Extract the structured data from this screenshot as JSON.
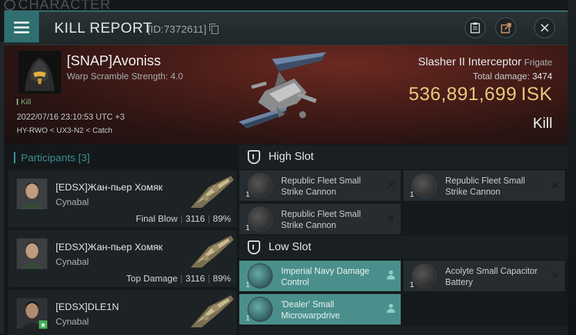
{
  "background": {
    "label": "CHARACTER"
  },
  "window": {
    "title": "KILL REPORT",
    "id_text": "[ID:7372611]",
    "accent": "#2f6f6f"
  },
  "victim": {
    "pilot": "[SNAP]Avoniss",
    "warp_text": "Warp Scramble Strength: 4.0",
    "kill_tag": "Kill",
    "timestamp": "2022/07/16 23:10:53 UTC +3",
    "route": "HY-RWO < UX3-N2 < Catch",
    "ship_name": "Slasher II Interceptor",
    "ship_class": "Frigate",
    "damage_label": "Total damage:",
    "damage_value": "3474",
    "isk_value": "536,891,699",
    "isk_unit": "ISK",
    "result": "Kill"
  },
  "participants": {
    "header": "Participants [3]",
    "rows": [
      {
        "name": "[EDSX]Жан-пьер Хомяк",
        "corp": "Cynabal",
        "role": "Final Blow",
        "damage": "3116",
        "percent": "89%"
      },
      {
        "name": "[EDSX]Жан-пьер Хомяк",
        "corp": "Cynabal",
        "role": "Top Damage",
        "damage": "3116",
        "percent": "89%"
      },
      {
        "name": "[EDSX]DLE1N",
        "corp": "Cynabal",
        "role": "",
        "damage": "",
        "percent": ""
      }
    ]
  },
  "fitting": {
    "high_slot": {
      "label": "High Slot",
      "modules": [
        {
          "qty": "1",
          "name": "Republic Fleet Small Strike Cannon",
          "icon": "projectile-cannon-icon"
        },
        {
          "qty": "1",
          "name": "Republic Fleet Small Strike Cannon",
          "icon": "projectile-cannon-icon"
        },
        {
          "qty": "1",
          "name": "Republic Fleet Small Strike Cannon",
          "icon": "projectile-cannon-icon"
        }
      ]
    },
    "low_slot": {
      "label": "Low Slot",
      "modules": [
        {
          "qty": "1",
          "name": "Imperial Navy Damage Control",
          "icon": "damage-control-icon"
        },
        {
          "qty": "1",
          "name": "Acolyte Small Capacitor Battery",
          "icon": "capacitor-battery-icon"
        },
        {
          "qty": "1",
          "name": "'Dealer' Small Microwarpdrive",
          "icon": "microwarpdrive-icon"
        }
      ]
    }
  }
}
